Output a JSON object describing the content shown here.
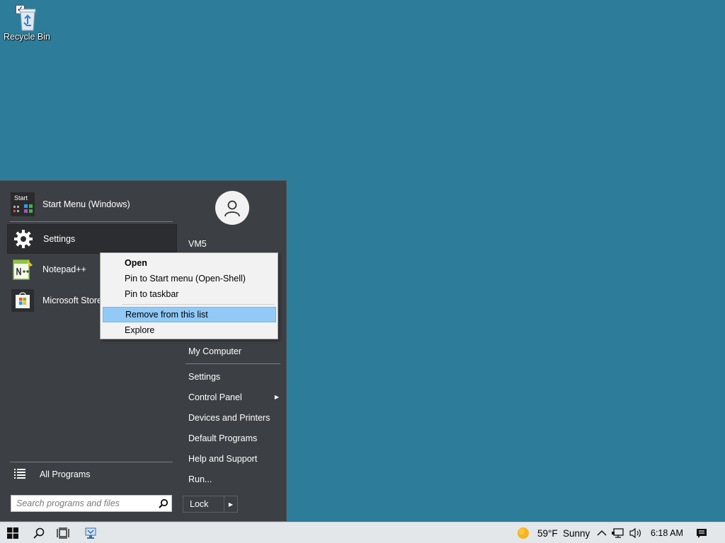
{
  "desktop": {
    "recycle_bin": {
      "label": "Recycle Bin"
    }
  },
  "start_menu": {
    "programs": [
      {
        "label": "Start Menu (Windows)",
        "icon": "start-menu-app-icon"
      },
      {
        "label": "Settings",
        "icon": "gear-icon"
      },
      {
        "label": "Notepad++",
        "icon": "notepad-plus-plus-icon"
      },
      {
        "label": "Microsoft Store",
        "icon": "store-bag-icon"
      }
    ],
    "start_tile_label": "Start",
    "all_programs": "All Programs",
    "search": {
      "placeholder": "Search programs and files"
    },
    "user": {
      "name": "VM5"
    },
    "right_items": [
      {
        "label": "My Computer"
      },
      {
        "label": "Settings"
      },
      {
        "label": "Control Panel"
      },
      {
        "label": "Devices and Printers"
      },
      {
        "label": "Default Programs"
      },
      {
        "label": "Help and Support"
      },
      {
        "label": "Run..."
      }
    ],
    "lock_button": "Lock"
  },
  "context_menu": {
    "items": [
      {
        "label": "Open",
        "bold": true
      },
      {
        "label": "Pin to Start menu (Open-Shell)"
      },
      {
        "label": "Pin to taskbar"
      },
      {
        "label": "Remove from this list",
        "highlighted": true
      },
      {
        "label": "Explore"
      }
    ]
  },
  "taskbar": {
    "weather": {
      "temp": "59°F",
      "condition": "Sunny"
    },
    "time": "6:18 AM"
  },
  "colors": {
    "desktop": "#2d7d9a",
    "start_menu_bg": "#3c4044",
    "context_highlight": "#91c9f7",
    "taskbar_bg": "#e3e7ea"
  }
}
